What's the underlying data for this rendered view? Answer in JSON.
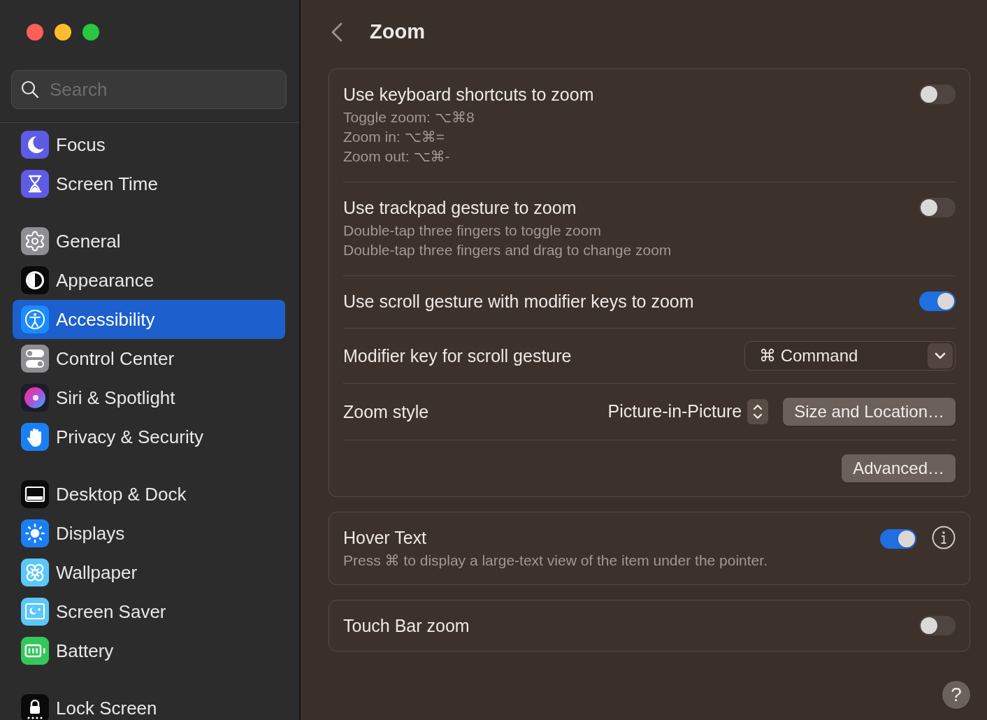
{
  "sidebar": {
    "search": {
      "placeholder": "Search"
    },
    "groups": [
      {
        "items": [
          {
            "label": "Focus",
            "selected": false
          },
          {
            "label": "Screen Time",
            "selected": false
          }
        ]
      },
      {
        "items": [
          {
            "label": "General",
            "selected": false
          },
          {
            "label": "Appearance",
            "selected": false
          },
          {
            "label": "Accessibility",
            "selected": true
          },
          {
            "label": "Control Center",
            "selected": false
          },
          {
            "label": "Siri & Spotlight",
            "selected": false
          },
          {
            "label": "Privacy & Security",
            "selected": false
          }
        ]
      },
      {
        "items": [
          {
            "label": "Desktop & Dock",
            "selected": false
          },
          {
            "label": "Displays",
            "selected": false
          },
          {
            "label": "Wallpaper",
            "selected": false
          },
          {
            "label": "Screen Saver",
            "selected": false
          },
          {
            "label": "Battery",
            "selected": false
          }
        ]
      },
      {
        "items": [
          {
            "label": "Lock Screen",
            "selected": false
          }
        ]
      }
    ]
  },
  "page": {
    "title": "Zoom"
  },
  "sections": [
    {
      "rows": [
        {
          "kind": "toggle",
          "title": "Use keyboard shortcuts to zoom",
          "description": [
            "Toggle zoom: ⌥⌘8",
            "Zoom in: ⌥⌘=",
            "Zoom out: ⌥⌘-"
          ],
          "on": false
        },
        {
          "kind": "toggle",
          "title": "Use trackpad gesture to zoom",
          "description": [
            "Double-tap three fingers to toggle zoom",
            "Double-tap three fingers and drag to change zoom"
          ],
          "on": false
        },
        {
          "kind": "toggle",
          "title": "Use scroll gesture with modifier keys to zoom",
          "on": true
        },
        {
          "kind": "dropdown",
          "label": "Modifier key for scroll gesture",
          "value": "⌘ Command"
        },
        {
          "kind": "popup",
          "label": "Zoom style",
          "value": "Picture-in-Picture",
          "button": "Size and Location…"
        },
        {
          "kind": "button",
          "button": "Advanced…"
        }
      ]
    },
    {
      "rows": [
        {
          "kind": "toggle",
          "title": "Hover Text",
          "description": [
            "Press ⌘ to display a large-text view of the item under the pointer."
          ],
          "on": true,
          "info": true
        }
      ]
    },
    {
      "rows": [
        {
          "kind": "toggle",
          "title": "Touch Bar zoom",
          "on": false
        }
      ]
    }
  ],
  "help_button": {
    "label": "?"
  }
}
